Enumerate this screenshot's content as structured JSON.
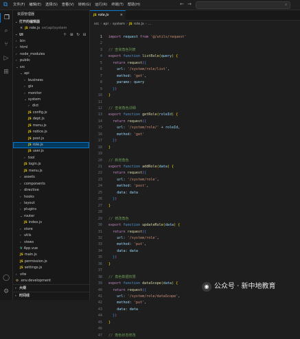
{
  "menubar": {
    "items": [
      "文件(F)",
      "编辑(E)",
      "选择(S)",
      "查看(V)",
      "转到(G)",
      "运行(R)",
      "终端(T)",
      "帮助(H)"
    ],
    "search_placeholder": ""
  },
  "sidebar": {
    "title": "资源管理器",
    "open_editors_label": "打开的编辑器",
    "open_files": [
      {
        "name": "role.js",
        "path": "src\\api\\system"
      }
    ],
    "project_label": "UI",
    "tree": [
      {
        "name": "bin",
        "type": "folder",
        "depth": 0,
        "open": false
      },
      {
        "name": "html",
        "type": "folder",
        "depth": 0,
        "open": false
      },
      {
        "name": "node_modules",
        "type": "folder",
        "depth": 0,
        "open": false
      },
      {
        "name": "public",
        "type": "folder",
        "depth": 0,
        "open": false
      },
      {
        "name": "src",
        "type": "folder",
        "depth": 0,
        "open": true
      },
      {
        "name": "api",
        "type": "folder",
        "depth": 1,
        "open": true
      },
      {
        "name": "business",
        "type": "folder",
        "depth": 2,
        "open": false
      },
      {
        "name": "gis",
        "type": "folder",
        "depth": 2,
        "open": false
      },
      {
        "name": "monitor",
        "type": "folder",
        "depth": 2,
        "open": false
      },
      {
        "name": "system",
        "type": "folder",
        "depth": 2,
        "open": true
      },
      {
        "name": "dict",
        "type": "folder",
        "depth": 3,
        "open": false
      },
      {
        "name": "config.js",
        "type": "js",
        "depth": 3
      },
      {
        "name": "dept.js",
        "type": "js",
        "depth": 3
      },
      {
        "name": "menu.js",
        "type": "js",
        "depth": 3
      },
      {
        "name": "notice.js",
        "type": "js",
        "depth": 3
      },
      {
        "name": "post.js",
        "type": "js",
        "depth": 3
      },
      {
        "name": "role.js",
        "type": "js",
        "depth": 3,
        "selected": true
      },
      {
        "name": "user.js",
        "type": "js",
        "depth": 3
      },
      {
        "name": "tool",
        "type": "folder",
        "depth": 2,
        "open": false
      },
      {
        "name": "login.js",
        "type": "js",
        "depth": 2
      },
      {
        "name": "menu.js",
        "type": "js",
        "depth": 2
      },
      {
        "name": "assets",
        "type": "folder",
        "depth": 1,
        "open": false
      },
      {
        "name": "components",
        "type": "folder",
        "depth": 1,
        "open": false
      },
      {
        "name": "directive",
        "type": "folder",
        "depth": 1,
        "open": false
      },
      {
        "name": "hooks",
        "type": "folder",
        "depth": 1,
        "open": false
      },
      {
        "name": "layout",
        "type": "folder",
        "depth": 1,
        "open": false
      },
      {
        "name": "plugins",
        "type": "folder",
        "depth": 1,
        "open": false
      },
      {
        "name": "router",
        "type": "folder",
        "depth": 1,
        "open": true
      },
      {
        "name": "index.js",
        "type": "js",
        "depth": 2
      },
      {
        "name": "store",
        "type": "folder",
        "depth": 1,
        "open": false
      },
      {
        "name": "utils",
        "type": "folder",
        "depth": 1,
        "open": false
      },
      {
        "name": "views",
        "type": "folder",
        "depth": 1,
        "open": false
      },
      {
        "name": "App.vue",
        "type": "vue",
        "depth": 1
      },
      {
        "name": "main.js",
        "type": "js",
        "depth": 1
      },
      {
        "name": "permission.js",
        "type": "js",
        "depth": 1
      },
      {
        "name": "settings.js",
        "type": "js",
        "depth": 1
      },
      {
        "name": "vite",
        "type": "folder",
        "depth": 0,
        "open": false
      },
      {
        "name": ".env.development",
        "type": "env",
        "depth": 0
      }
    ],
    "outline_label": "大纲",
    "timeline_label": "时间线"
  },
  "tabs": [
    {
      "label": "role.js",
      "close": "×"
    }
  ],
  "breadcrumb": [
    "src",
    "api",
    "system",
    "role.js",
    "..."
  ],
  "code_lines": [
    [
      [
        "kw",
        "import"
      ],
      [
        "pl",
        " "
      ],
      [
        "pr",
        "request"
      ],
      [
        "pl",
        " "
      ],
      [
        "kw",
        "from"
      ],
      [
        "pl",
        " "
      ],
      [
        "st",
        "'@/utils/request'"
      ]
    ],
    [],
    [
      [
        "cm",
        "// 查询角色列表"
      ]
    ],
    [
      [
        "kw",
        "export"
      ],
      [
        "pl",
        " "
      ],
      [
        "kb",
        "function"
      ],
      [
        "pl",
        " "
      ],
      [
        "fn",
        "listRole"
      ],
      [
        "br1",
        "("
      ],
      [
        "pr",
        "query"
      ],
      [
        "br1",
        ")"
      ],
      [
        "pl",
        " "
      ],
      [
        "br1",
        "{"
      ]
    ],
    [
      [
        "pl",
        "  "
      ],
      [
        "kw",
        "return"
      ],
      [
        "pl",
        " "
      ],
      [
        "fn",
        "request"
      ],
      [
        "br2",
        "("
      ],
      [
        "br3",
        "{"
      ]
    ],
    [
      [
        "pl",
        "    "
      ],
      [
        "pr",
        "url"
      ],
      [
        "pl",
        ": "
      ],
      [
        "st",
        "'/system/role/list'"
      ],
      [
        "pl",
        ","
      ]
    ],
    [
      [
        "pl",
        "    "
      ],
      [
        "pr",
        "method"
      ],
      [
        "pl",
        ": "
      ],
      [
        "st",
        "'get'"
      ],
      [
        "pl",
        ","
      ]
    ],
    [
      [
        "pl",
        "    "
      ],
      [
        "pr",
        "params"
      ],
      [
        "pl",
        ": "
      ],
      [
        "pr",
        "query"
      ]
    ],
    [
      [
        "pl",
        "  "
      ],
      [
        "br3",
        "}"
      ],
      [
        "br2",
        ")"
      ]
    ],
    [
      [
        "br1",
        "}"
      ]
    ],
    [],
    [
      [
        "cm",
        "// 查询角色详细"
      ]
    ],
    [
      [
        "kw",
        "export"
      ],
      [
        "pl",
        " "
      ],
      [
        "kb",
        "function"
      ],
      [
        "pl",
        " "
      ],
      [
        "fn",
        "getRole"
      ],
      [
        "br1",
        "("
      ],
      [
        "pr",
        "roleId"
      ],
      [
        "br1",
        ")"
      ],
      [
        "pl",
        " "
      ],
      [
        "br1",
        "{"
      ]
    ],
    [
      [
        "pl",
        "  "
      ],
      [
        "kw",
        "return"
      ],
      [
        "pl",
        " "
      ],
      [
        "fn",
        "request"
      ],
      [
        "br2",
        "("
      ],
      [
        "br3",
        "{"
      ]
    ],
    [
      [
        "pl",
        "    "
      ],
      [
        "pr",
        "url"
      ],
      [
        "pl",
        ": "
      ],
      [
        "st",
        "'/system/role/'"
      ],
      [
        "pl",
        " + "
      ],
      [
        "pr",
        "roleId"
      ],
      [
        "pl",
        ","
      ]
    ],
    [
      [
        "pl",
        "    "
      ],
      [
        "pr",
        "method"
      ],
      [
        "pl",
        ": "
      ],
      [
        "st",
        "'get'"
      ]
    ],
    [
      [
        "pl",
        "  "
      ],
      [
        "br3",
        "}"
      ],
      [
        "br2",
        ")"
      ]
    ],
    [
      [
        "br1",
        "}"
      ]
    ],
    [],
    [
      [
        "cm",
        "// 新增角色"
      ]
    ],
    [
      [
        "kw",
        "export"
      ],
      [
        "pl",
        " "
      ],
      [
        "kb",
        "function"
      ],
      [
        "pl",
        " "
      ],
      [
        "fn",
        "addRole"
      ],
      [
        "br1",
        "("
      ],
      [
        "pr",
        "data"
      ],
      [
        "br1",
        ")"
      ],
      [
        "pl",
        " "
      ],
      [
        "br1",
        "{"
      ]
    ],
    [
      [
        "pl",
        "  "
      ],
      [
        "kw",
        "return"
      ],
      [
        "pl",
        " "
      ],
      [
        "fn",
        "request"
      ],
      [
        "br2",
        "("
      ],
      [
        "br3",
        "{"
      ]
    ],
    [
      [
        "pl",
        "    "
      ],
      [
        "pr",
        "url"
      ],
      [
        "pl",
        ": "
      ],
      [
        "st",
        "'/system/role'"
      ],
      [
        "pl",
        ","
      ]
    ],
    [
      [
        "pl",
        "    "
      ],
      [
        "pr",
        "method"
      ],
      [
        "pl",
        ": "
      ],
      [
        "st",
        "'post'"
      ],
      [
        "pl",
        ","
      ]
    ],
    [
      [
        "pl",
        "    "
      ],
      [
        "pr",
        "data"
      ],
      [
        "pl",
        ": "
      ],
      [
        "pr",
        "data"
      ]
    ],
    [
      [
        "pl",
        "  "
      ],
      [
        "br3",
        "}"
      ],
      [
        "br2",
        ")"
      ]
    ],
    [
      [
        "br1",
        "}"
      ]
    ],
    [],
    [
      [
        "cm",
        "// 修改角色"
      ]
    ],
    [
      [
        "kw",
        "export"
      ],
      [
        "pl",
        " "
      ],
      [
        "kb",
        "function"
      ],
      [
        "pl",
        " "
      ],
      [
        "fn",
        "updateRole"
      ],
      [
        "br1",
        "("
      ],
      [
        "pr",
        "data"
      ],
      [
        "br1",
        ")"
      ],
      [
        "pl",
        " "
      ],
      [
        "br1",
        "{"
      ]
    ],
    [
      [
        "pl",
        "  "
      ],
      [
        "kw",
        "return"
      ],
      [
        "pl",
        " "
      ],
      [
        "fn",
        "request"
      ],
      [
        "br2",
        "("
      ],
      [
        "br3",
        "{"
      ]
    ],
    [
      [
        "pl",
        "    "
      ],
      [
        "pr",
        "url"
      ],
      [
        "pl",
        ": "
      ],
      [
        "st",
        "'/system/role'"
      ],
      [
        "pl",
        ","
      ]
    ],
    [
      [
        "pl",
        "    "
      ],
      [
        "pr",
        "method"
      ],
      [
        "pl",
        ": "
      ],
      [
        "st",
        "'put'"
      ],
      [
        "pl",
        ","
      ]
    ],
    [
      [
        "pl",
        "    "
      ],
      [
        "pr",
        "data"
      ],
      [
        "pl",
        ": "
      ],
      [
        "pr",
        "data"
      ]
    ],
    [
      [
        "pl",
        "  "
      ],
      [
        "br3",
        "}"
      ],
      [
        "br2",
        ")"
      ]
    ],
    [
      [
        "br1",
        "}"
      ]
    ],
    [],
    [
      [
        "cm",
        "// 角色数据权限"
      ]
    ],
    [
      [
        "kw",
        "export"
      ],
      [
        "pl",
        " "
      ],
      [
        "kb",
        "function"
      ],
      [
        "pl",
        " "
      ],
      [
        "fn",
        "dataScope"
      ],
      [
        "br1",
        "("
      ],
      [
        "pr",
        "data"
      ],
      [
        "br1",
        ")"
      ],
      [
        "pl",
        " "
      ],
      [
        "br1",
        "{"
      ]
    ],
    [
      [
        "pl",
        "  "
      ],
      [
        "kw",
        "return"
      ],
      [
        "pl",
        " "
      ],
      [
        "fn",
        "request"
      ],
      [
        "br2",
        "("
      ],
      [
        "br3",
        "{"
      ]
    ],
    [
      [
        "pl",
        "    "
      ],
      [
        "pr",
        "url"
      ],
      [
        "pl",
        ": "
      ],
      [
        "st",
        "'/system/role/dataScope'"
      ],
      [
        "pl",
        ","
      ]
    ],
    [
      [
        "pl",
        "    "
      ],
      [
        "pr",
        "method"
      ],
      [
        "pl",
        ": "
      ],
      [
        "st",
        "'put'"
      ],
      [
        "pl",
        ","
      ]
    ],
    [
      [
        "pl",
        "    "
      ],
      [
        "pr",
        "data"
      ],
      [
        "pl",
        ": "
      ],
      [
        "pr",
        "data"
      ]
    ],
    [
      [
        "pl",
        "  "
      ],
      [
        "br3",
        "}"
      ],
      [
        "br2",
        ")"
      ]
    ],
    [
      [
        "br1",
        "}"
      ]
    ],
    [],
    [
      [
        "cm",
        "// 角色状态修改"
      ]
    ]
  ],
  "watermark": {
    "text": "公众号 · 新中地教育"
  },
  "colors": {
    "accent": "#0078d4",
    "selection": "#04395e",
    "js_badge": "#e6c800"
  }
}
